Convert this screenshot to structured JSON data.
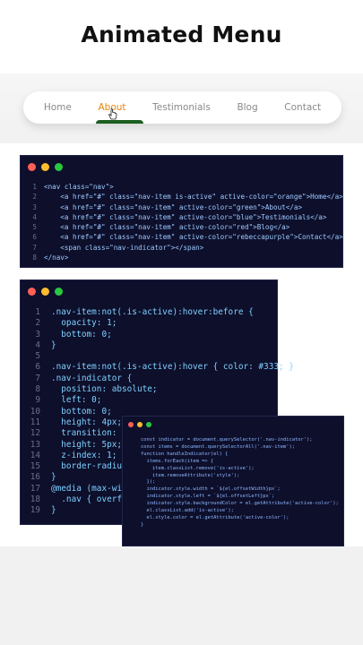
{
  "title": "Animated Menu",
  "nav": {
    "items": [
      "Home",
      "About",
      "Testimonials",
      "Blog",
      "Contact"
    ],
    "active_index": 1,
    "active_color": "#e8860a",
    "indicator_color": "#1b5e20"
  },
  "panel_html": {
    "lines": [
      "<nav class=\"nav\">",
      "    <a href=\"#\" class=\"nav-item is-active\" active-color=\"orange\">Home</a>",
      "    <a href=\"#\" class=\"nav-item\" active-color=\"green\">About</a>",
      "    <a href=\"#\" class=\"nav-item\" active-color=\"blue\">Testimonials</a>",
      "    <a href=\"#\" class=\"nav-item\" active-color=\"red\">Blog</a>",
      "    <a href=\"#\" class=\"nav-item\" active-color=\"rebeccapurple\">Contact</a>",
      "    <span class=\"nav-indicator\"></span>",
      "</nav>"
    ]
  },
  "panel_css": {
    "lines": [
      ".nav-item:not(.is-active):hover:before {",
      "  opacity: 1;",
      "  bottom: 0;",
      "}",
      "",
      ".nav-item:not(.is-active):hover { color: #333; }",
      ".nav-indicator {",
      "  position: absolute;",
      "  left: 0;",
      "  bottom: 0;",
      "  height: 4px;",
      "  transition: .4",
      "  height: 5px;",
      "  z-index: 1;",
      "  border-radius:",
      "}",
      "@media (max-widt",
      "  .nav { overflo",
      "}"
    ]
  },
  "panel_js": {
    "lines": [
      "const indicator = document.querySelector('.nav-indicator');",
      "const items = document.querySelectorAll('.nav-item');",
      "",
      "function handleIndicator(el) {",
      "  items.forEach(item => {",
      "    item.classList.remove('is-active');",
      "    item.removeAttribute('style');",
      "  });",
      "",
      "  indicator.style.width = `${el.offsetWidth}px`;",
      "  indicator.style.left = `${el.offsetLeft}px`;",
      "  indicator.style.backgroundColor = el.getAttribute('active-color');",
      "",
      "  el.classList.add('is-active');",
      "  el.style.color = el.getAttribute('active-color');",
      "}"
    ]
  }
}
